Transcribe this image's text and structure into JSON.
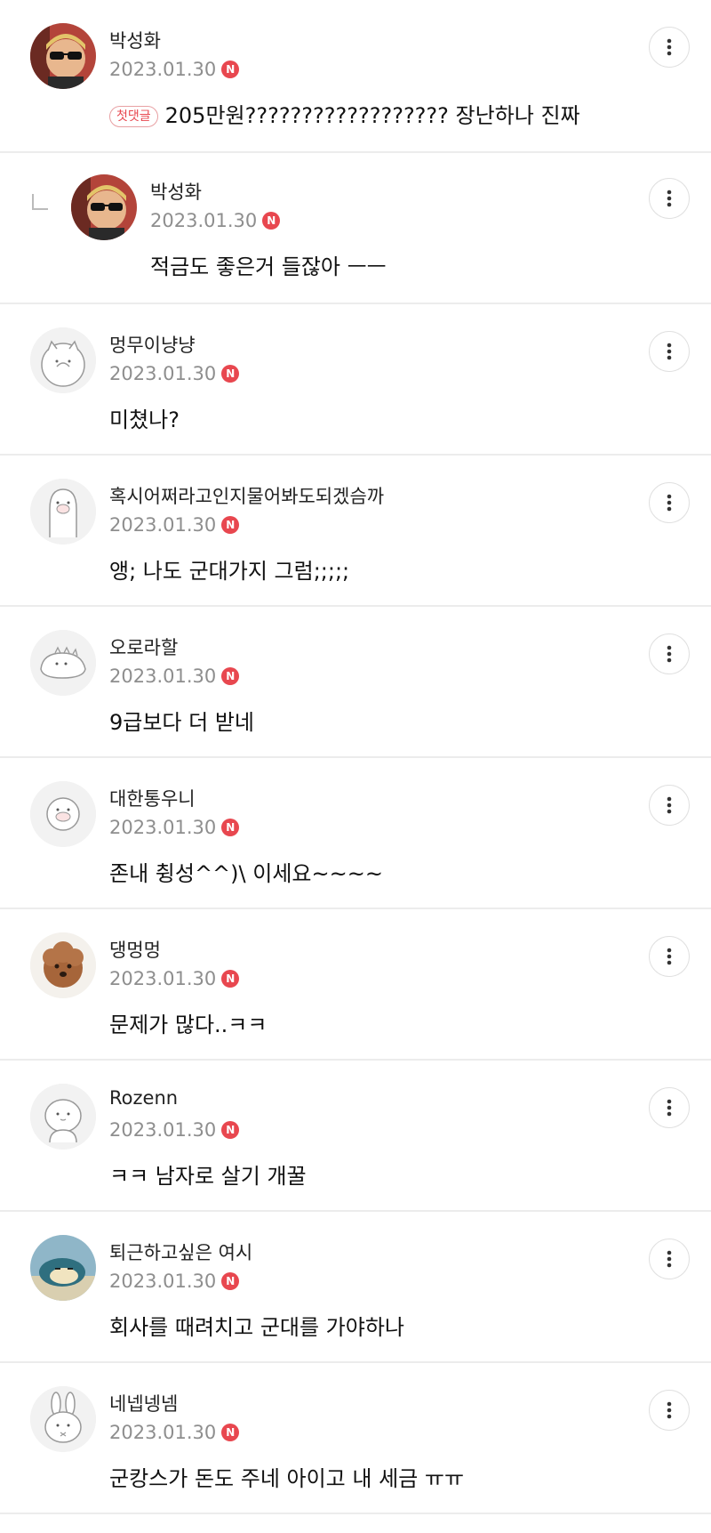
{
  "comments": [
    {
      "nick": "박성화",
      "date": "2023.01.30",
      "new_badge": "N",
      "first_label": "첫댓글",
      "text": "205만원?????????????????? 장난하나 진짜",
      "avatar": "sunglasses-man"
    },
    {
      "nick": "박성화",
      "date": "2023.01.30",
      "new_badge": "N",
      "text": "적금도 좋은거 들잖아 ㅡㅡ",
      "avatar": "sunglasses-man"
    },
    {
      "nick": "멍무이냥냥",
      "date": "2023.01.30",
      "new_badge": "N",
      "text": "미쳤나?",
      "avatar": "cat-sketch"
    },
    {
      "nick": "혹시어쩌라고인지물어봐도되겠슴까",
      "date": "2023.01.30",
      "new_badge": "N",
      "text": "앵; 나도 군대가지 그럼;;;;;",
      "avatar": "penguin-pig"
    },
    {
      "nick": "오로라할",
      "date": "2023.01.30",
      "new_badge": "N",
      "text": "9급보다 더 받네",
      "avatar": "dinosaur"
    },
    {
      "nick": "대한통우니",
      "date": "2023.01.30",
      "new_badge": "N",
      "text": "존내 췽성^^)\\ 이세요~~~~",
      "avatar": "pig-face"
    },
    {
      "nick": "댕멍멍",
      "date": "2023.01.30",
      "new_badge": "N",
      "text": "문제가 많다..ㅋㅋ",
      "avatar": "poodle"
    },
    {
      "nick": "Rozenn",
      "date": "2023.01.30",
      "new_badge": "N",
      "text": "ㅋㅋ 남자로 살기 개꿀",
      "avatar": "round-face"
    },
    {
      "nick": "퇴근하고싶은 여시",
      "date": "2023.01.30",
      "new_badge": "N",
      "text": "회사를 때려치고 군대를 가야하나",
      "avatar": "sleeping-creature"
    },
    {
      "nick": "네넵넹넴",
      "date": "2023.01.30",
      "new_badge": "N",
      "text": "군캉스가 돈도 주네 아이고 내 세금 ㅠㅠ",
      "avatar": "rabbit"
    }
  ],
  "icons": {
    "more": "more-vertical-icon",
    "reply": "reply-indent-icon"
  },
  "colors": {
    "badge": "#e8474f",
    "meta": "#8e8e8e",
    "divider": "#ececec"
  }
}
